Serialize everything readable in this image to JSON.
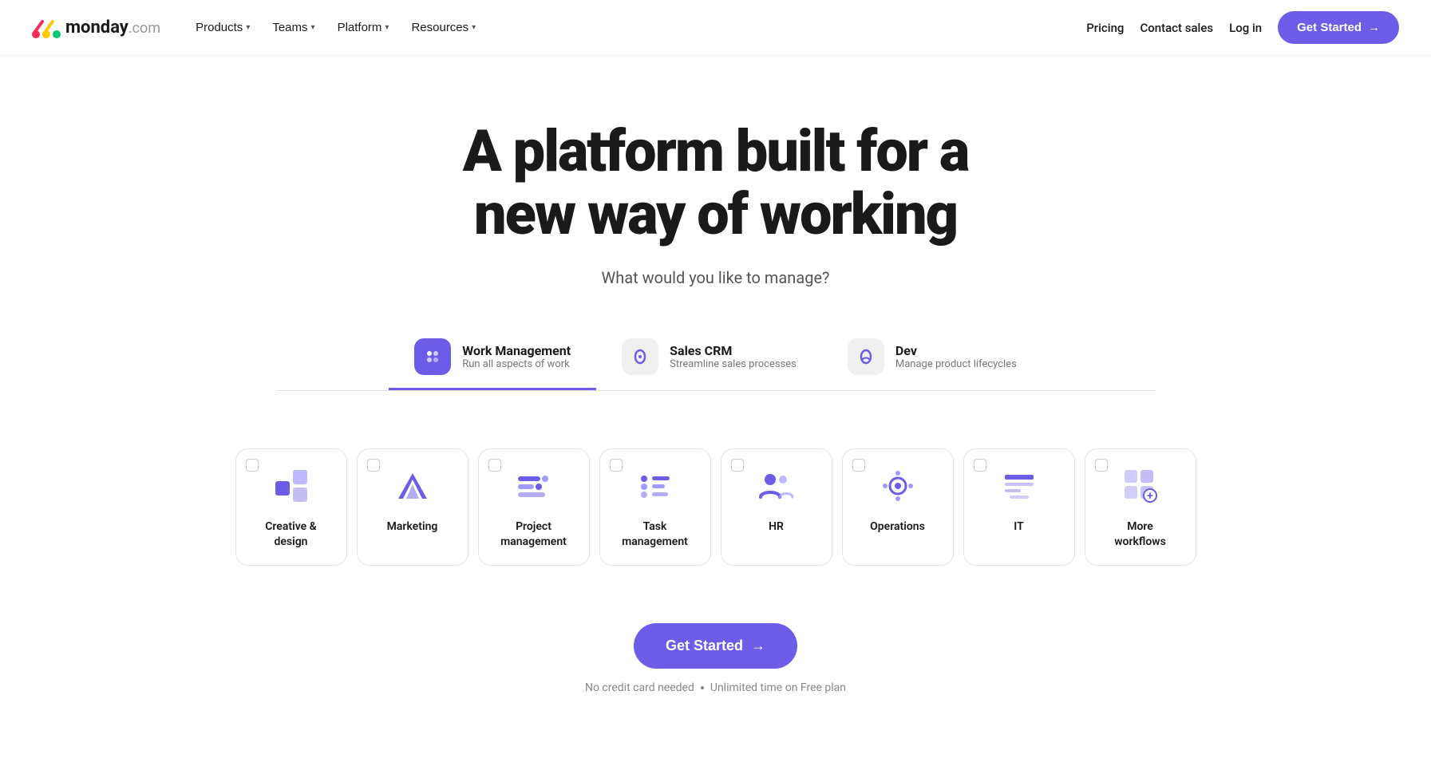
{
  "nav": {
    "logo_text": "monday",
    "logo_suffix": ".com",
    "links": [
      {
        "label": "Products",
        "has_chevron": true
      },
      {
        "label": "Teams",
        "has_chevron": true
      },
      {
        "label": "Platform",
        "has_chevron": true
      },
      {
        "label": "Resources",
        "has_chevron": true
      }
    ],
    "right_links": [
      {
        "label": "Pricing"
      },
      {
        "label": "Contact sales"
      },
      {
        "label": "Log in"
      }
    ],
    "cta_label": "Get Started",
    "cta_arrow": "→"
  },
  "hero": {
    "title_line1": "A platform built for a",
    "title_line2": "new way of working",
    "subtitle": "What would you like to manage?"
  },
  "tabs": [
    {
      "id": "work-management",
      "title": "Work Management",
      "desc": "Run all aspects of work",
      "active": true,
      "icon_bg": "purple"
    },
    {
      "id": "sales-crm",
      "title": "Sales CRM",
      "desc": "Streamline sales processes",
      "active": false,
      "icon_bg": "gray"
    },
    {
      "id": "dev",
      "title": "Dev",
      "desc": "Manage product lifecycles",
      "active": false,
      "icon_bg": "gray"
    }
  ],
  "workflow_cards": [
    {
      "id": "creative-design",
      "label": "Creative &\ndesign",
      "icon": "creative"
    },
    {
      "id": "marketing",
      "label": "Marketing",
      "icon": "marketing"
    },
    {
      "id": "project-management",
      "label": "Project\nmanagement",
      "icon": "project"
    },
    {
      "id": "task-management",
      "label": "Task\nmanagement",
      "icon": "task"
    },
    {
      "id": "hr",
      "label": "HR",
      "icon": "hr"
    },
    {
      "id": "operations",
      "label": "Operations",
      "icon": "operations"
    },
    {
      "id": "it",
      "label": "IT",
      "icon": "it"
    },
    {
      "id": "more-workflows",
      "label": "More\nworkflows",
      "icon": "more"
    }
  ],
  "cta": {
    "label": "Get Started",
    "arrow": "→",
    "note1": "No credit card needed",
    "note2": "Unlimited time on Free plan"
  }
}
